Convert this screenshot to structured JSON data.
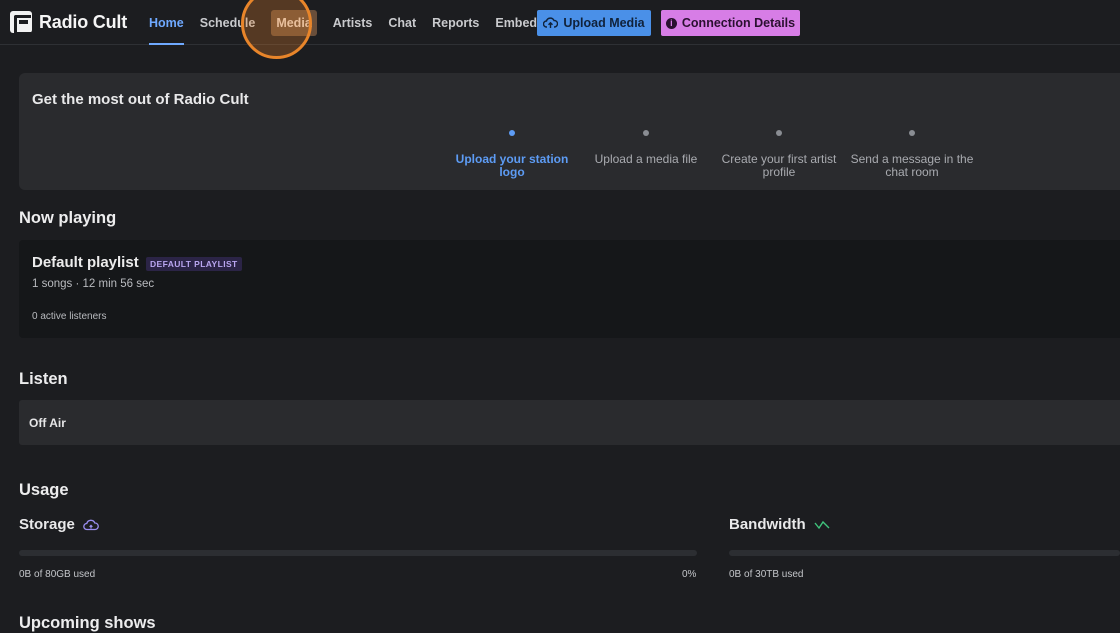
{
  "app": {
    "name": "Radio Cult"
  },
  "nav": {
    "items": [
      "Home",
      "Schedule",
      "Media",
      "Artists",
      "Chat",
      "Reports",
      "Embeds"
    ],
    "active": "Home",
    "highlighted": "Media"
  },
  "actions": {
    "upload_label": "Upload Media",
    "connection_label": "Connection Details",
    "upload_color": "#4a90e8",
    "connection_color": "#d77de6"
  },
  "onboarding": {
    "title": "Get the most out of Radio Cult",
    "steps": [
      {
        "label": "Upload your station logo"
      },
      {
        "label": "Upload a media file"
      },
      {
        "label": "Create your first artist profile"
      },
      {
        "label": "Send a message in the chat room"
      }
    ],
    "current_step": 0
  },
  "now_playing": {
    "section_title": "Now playing",
    "playlist_name": "Default playlist",
    "badge": "DEFAULT PLAYLIST",
    "meta": "1 songs · 12 min 56 sec",
    "listeners": "0 active listeners"
  },
  "listen": {
    "section_title": "Listen",
    "status": "Off Air"
  },
  "usage": {
    "section_title": "Usage",
    "storage": {
      "label": "Storage",
      "used_text": "0B of 80GB used",
      "percent_text": "0%",
      "fraction": 0
    },
    "bandwidth": {
      "label": "Bandwidth",
      "used_text": "0B of 30TB used",
      "fraction": 0
    }
  },
  "upcoming": {
    "section_title": "Upcoming shows"
  }
}
